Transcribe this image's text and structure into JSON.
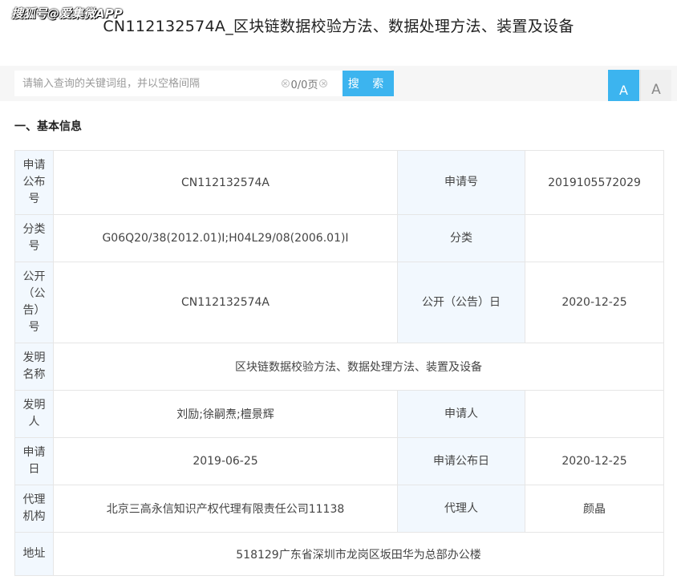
{
  "watermark": "搜狐号@爱集微APP",
  "document": {
    "title": "CN112132574A_区块链数据校验方法、数据处理方法、装置及设备"
  },
  "toolbar": {
    "search_placeholder": "请输入查询的关键词组，并以空格间隔",
    "page_counter": "0/0页",
    "search_label": "搜 索",
    "font_large": "A",
    "font_small": "A"
  },
  "section": {
    "heading": "一、基本信息"
  },
  "info": {
    "application_publication_no_label": "申请公布号",
    "application_publication_no": "CN112132574A",
    "application_no_label": "申请号",
    "application_no": "2019105572029",
    "classification_no_label": "分类号",
    "classification_no": "G06Q20/38(2012.01)I;H04L29/08(2006.01)I",
    "classification_label": "分类",
    "classification": "",
    "publication_no_label": "公开（公告）号",
    "publication_no": "CN112132574A",
    "publication_date_label": "公开（公告）日",
    "publication_date": "2020-12-25",
    "invention_name_label": "发明名称",
    "invention_name": "区块链数据校验方法、数据处理方法、装置及设备",
    "inventor_label": "发明人",
    "inventor": "刘励;徐嗣焘;檀景辉",
    "applicant_label": "申请人",
    "applicant": "",
    "application_date_label": "申请日",
    "application_date": "2019-06-25",
    "application_publication_date_label": "申请公布日",
    "application_publication_date": "2020-12-25",
    "agency_label": "代理机构",
    "agency": "北京三高永信知识产权代理有限责任公司11138",
    "agent_label": "代理人",
    "agent": "颜晶",
    "address_label": "地址",
    "address": "518129广东省深圳市龙岗区坂田华为总部办公楼"
  }
}
